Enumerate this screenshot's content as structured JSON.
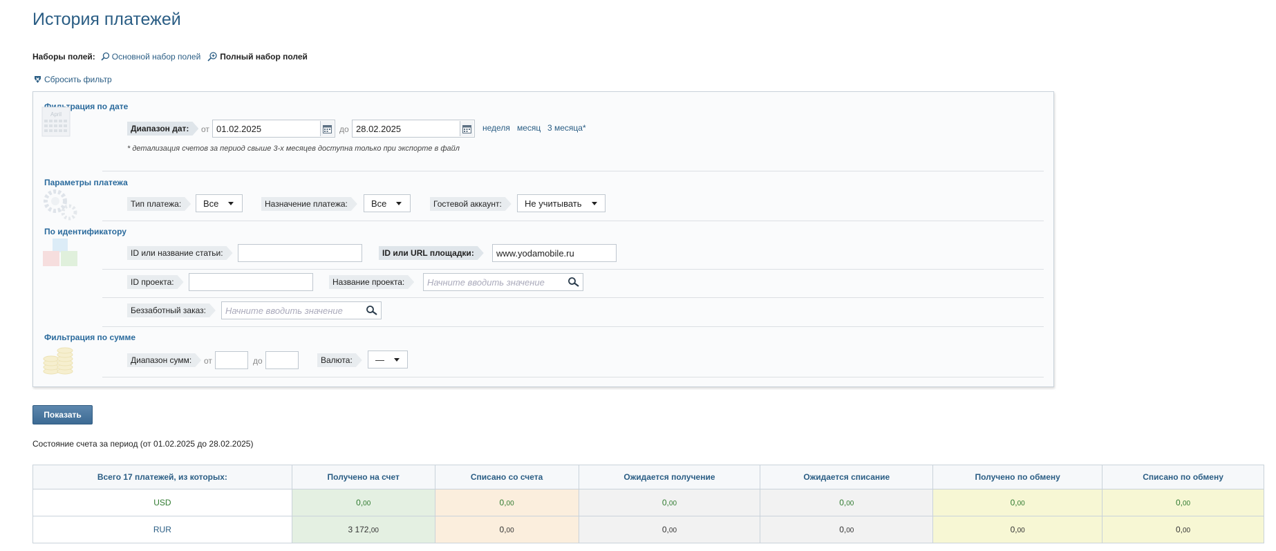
{
  "page": {
    "title": "История платежей"
  },
  "fieldsets": {
    "label": "Наборы полей:",
    "basic": "Основной набор полей",
    "full": "Полный набор полей"
  },
  "reset_filter": "Сбросить фильтр",
  "date_filter": {
    "title": "Фильтрация по дате",
    "calendar_word": "April",
    "range_label": "Диапазон дат:",
    "from_label": "от",
    "from_value": "01.02.2025",
    "to_label": "до",
    "to_value": "28.02.2025",
    "quick": [
      "неделя",
      "месяц",
      "3 месяца*"
    ],
    "note": "* детализация счетов за период свыше 3-х месяцев доступна только при экспорте в файл"
  },
  "payment_params": {
    "title": "Параметры платежа",
    "type_label": "Тип платежа:",
    "type_value": "Все",
    "purpose_label": "Назначение платежа:",
    "purpose_value": "Все",
    "guest_label": "Гостевой аккаунт:",
    "guest_value": "Не учитывать"
  },
  "by_id": {
    "title": "По идентификатору",
    "article_label": "ID или название статьи:",
    "article_value": "",
    "site_label": "ID или URL площадки:",
    "site_value": "www.yodamobile.ru",
    "project_id_label": "ID проекта:",
    "project_id_value": "",
    "project_name_label": "Название проекта:",
    "project_name_placeholder": "Начните вводить значение",
    "order_label": "Беззаботный заказ:",
    "order_placeholder": "Начните вводить значение"
  },
  "sum_filter": {
    "title": "Фильтрация по сумме",
    "range_label": "Диапазон сумм:",
    "from_label": "от",
    "to_label": "до",
    "currency_label": "Валюта:",
    "currency_value": "—"
  },
  "show_button": "Показать",
  "period_text": "Состояние счета за период (от 01.02.2025 до 28.02.2025)",
  "summary": {
    "headers": [
      "Всего 17 платежей, из которых:",
      "Получено на счет",
      "Списано со счета",
      "Ожидается получение",
      "Ожидается списание",
      "Получено по обмену",
      "Списано по обмену"
    ],
    "rows": [
      {
        "currency": "USD",
        "values": [
          [
            "0,",
            "00"
          ],
          [
            "0,",
            "00"
          ],
          [
            "0,",
            "00"
          ],
          [
            "0,",
            "00"
          ],
          [
            "0,",
            "00"
          ],
          [
            "0,",
            "00"
          ]
        ]
      },
      {
        "currency": "RUR",
        "values": [
          [
            "3 172,",
            "00"
          ],
          [
            "0,",
            "00"
          ],
          [
            "0,",
            "00"
          ],
          [
            "0,",
            "00"
          ],
          [
            "0,",
            "00"
          ],
          [
            "0,",
            "00"
          ]
        ]
      }
    ]
  },
  "colors": {
    "title": "#2a5d84",
    "received": "#e4f0e2",
    "debited": "#fbeedd",
    "pending": "#f2f2f2",
    "exchange": "#f7f7d4"
  }
}
